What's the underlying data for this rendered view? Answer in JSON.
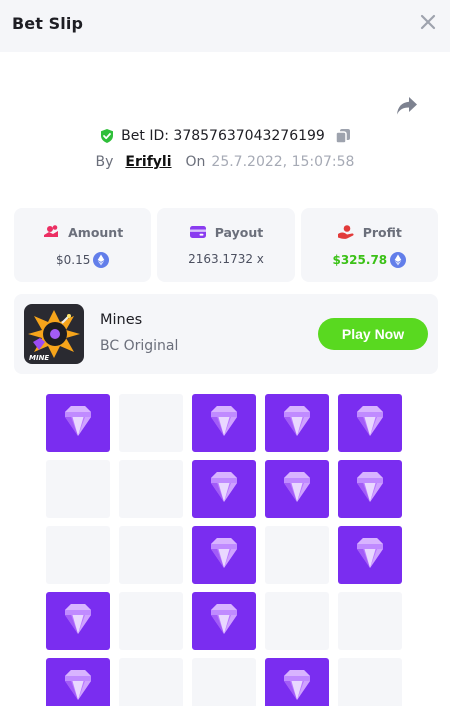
{
  "header": {
    "title": "Bet Slip",
    "close_icon": "close-icon"
  },
  "bet": {
    "id_text": "Bet ID: 37857637043276199",
    "by_label": "By",
    "user": "Erifyli",
    "on_label": "On",
    "datetime": "25.7.2022, 15:07:58"
  },
  "stats": {
    "amount": {
      "label": "Amount",
      "value": "$0.15",
      "icon": "coins-icon",
      "currency_icon": "ethereum-icon"
    },
    "payout": {
      "label": "Payout",
      "value": "2163.1732 x",
      "icon": "card-icon"
    },
    "profit": {
      "label": "Profit",
      "value": "$325.78",
      "icon": "hand-coin-icon",
      "currency_icon": "ethereum-icon"
    }
  },
  "game": {
    "name": "Mines",
    "provider": "BC Original",
    "thumb_label": "MINE",
    "play_label": "Play Now"
  },
  "colors": {
    "accent_green": "#59d920",
    "profit_green": "#3bc117",
    "gem_purple": "#7a2df0",
    "panel_bg": "#f5f6f9"
  },
  "board": {
    "columns": 5,
    "tiles": [
      "gem",
      "empty",
      "gem",
      "gem",
      "gem",
      "empty",
      "empty",
      "gem",
      "gem",
      "gem",
      "empty",
      "empty",
      "gem",
      "empty",
      "gem",
      "gem",
      "empty",
      "gem",
      "empty",
      "empty",
      "gem",
      "empty",
      "empty",
      "gem",
      "empty"
    ]
  }
}
